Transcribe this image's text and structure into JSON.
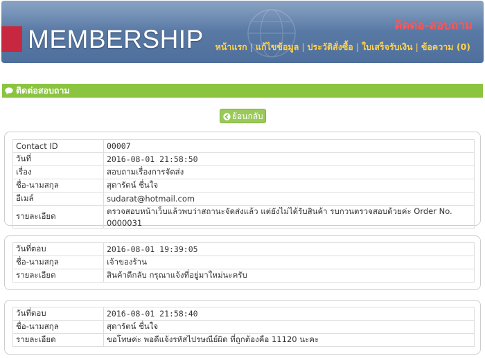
{
  "header": {
    "brand": "MEMBERSHIP",
    "page_title": "ติดต่อ-สอบถาม",
    "nav": [
      "หน้าแรก",
      "แก้ไขข้อมูล",
      "ประวัติสั่งซื้อ",
      "ใบเสร็จรับเงิน",
      "ข้อความ (0)"
    ]
  },
  "section": {
    "title": "ติดต่อสอบถาม",
    "icon": "chat-bubble-icon"
  },
  "back_button": {
    "label": "ย้อนกลับ",
    "icon": "arrow-left-circle-icon"
  },
  "contact": {
    "rows": [
      {
        "label": "Contact ID",
        "value": "00007"
      },
      {
        "label": "วันที่",
        "value": "2016-08-01 21:58:50"
      },
      {
        "label": "เรื่อง",
        "value": "สอบถามเรื่องการจัดส่ง"
      },
      {
        "label": "ชื่อ-นามสกุล",
        "value": "สุดารัตน์ ชื่นใจ"
      },
      {
        "label": "อีเมล์",
        "value": "sudarat@hotmail.com"
      },
      {
        "label": "รายละเอียด",
        "value": "ตรวจสอบหน้าเว็บแล้วพบว่าสถานะจัดส่งแล้ว แต่ยังไม่ได้รับสินค้า รบกวนตรวจสอบด้วยค่ะ Order No. 0000031"
      }
    ]
  },
  "replies": [
    {
      "rows": [
        {
          "label": "วันที่ตอบ",
          "value": "2016-08-01 19:39:05"
        },
        {
          "label": "ชื่อ-นามสกุล",
          "value": "เจ้าของร้าน"
        },
        {
          "label": "รายละเอียด",
          "value": "สินค้าตีกลับ กรุณาแจ้งที่อยู่มาใหม่นะครับ"
        }
      ]
    },
    {
      "rows": [
        {
          "label": "วันที่ตอบ",
          "value": "2016-08-01 21:58:40"
        },
        {
          "label": "ชื่อ-นามสกุล",
          "value": "สุดารัตน์ ชื่นใจ"
        },
        {
          "label": "รายละเอียด",
          "value": "ขอโทษค่ะ พอดีแจ้งรหัสไปรษณีย์ผิด ที่ถูกต้องคือ 11120 นะคะ"
        }
      ]
    }
  ]
}
